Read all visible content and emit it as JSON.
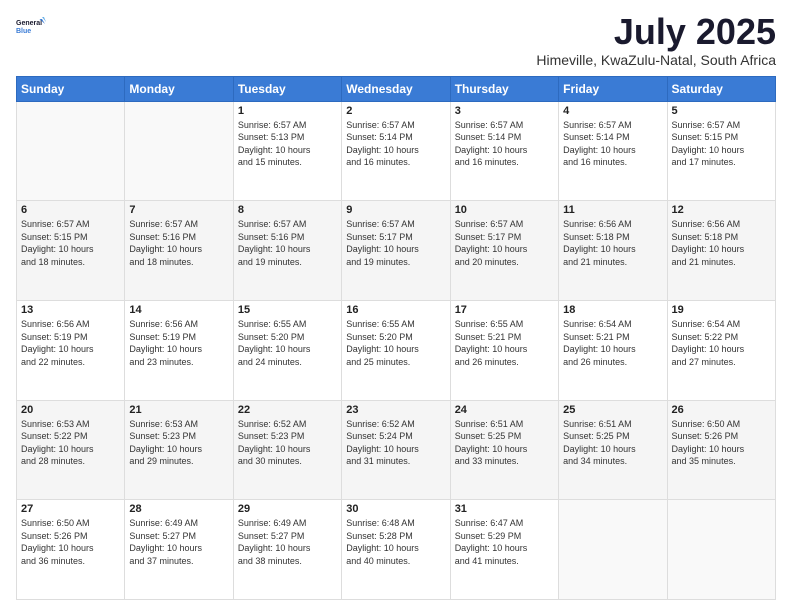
{
  "logo": {
    "line1": "General",
    "line2": "Blue"
  },
  "title": "July 2025",
  "subtitle": "Himeville, KwaZulu-Natal, South Africa",
  "days_of_week": [
    "Sunday",
    "Monday",
    "Tuesday",
    "Wednesday",
    "Thursday",
    "Friday",
    "Saturday"
  ],
  "weeks": [
    [
      {
        "day": "",
        "info": ""
      },
      {
        "day": "",
        "info": ""
      },
      {
        "day": "1",
        "info": "Sunrise: 6:57 AM\nSunset: 5:13 PM\nDaylight: 10 hours\nand 15 minutes."
      },
      {
        "day": "2",
        "info": "Sunrise: 6:57 AM\nSunset: 5:14 PM\nDaylight: 10 hours\nand 16 minutes."
      },
      {
        "day": "3",
        "info": "Sunrise: 6:57 AM\nSunset: 5:14 PM\nDaylight: 10 hours\nand 16 minutes."
      },
      {
        "day": "4",
        "info": "Sunrise: 6:57 AM\nSunset: 5:14 PM\nDaylight: 10 hours\nand 16 minutes."
      },
      {
        "day": "5",
        "info": "Sunrise: 6:57 AM\nSunset: 5:15 PM\nDaylight: 10 hours\nand 17 minutes."
      }
    ],
    [
      {
        "day": "6",
        "info": "Sunrise: 6:57 AM\nSunset: 5:15 PM\nDaylight: 10 hours\nand 18 minutes."
      },
      {
        "day": "7",
        "info": "Sunrise: 6:57 AM\nSunset: 5:16 PM\nDaylight: 10 hours\nand 18 minutes."
      },
      {
        "day": "8",
        "info": "Sunrise: 6:57 AM\nSunset: 5:16 PM\nDaylight: 10 hours\nand 19 minutes."
      },
      {
        "day": "9",
        "info": "Sunrise: 6:57 AM\nSunset: 5:17 PM\nDaylight: 10 hours\nand 19 minutes."
      },
      {
        "day": "10",
        "info": "Sunrise: 6:57 AM\nSunset: 5:17 PM\nDaylight: 10 hours\nand 20 minutes."
      },
      {
        "day": "11",
        "info": "Sunrise: 6:56 AM\nSunset: 5:18 PM\nDaylight: 10 hours\nand 21 minutes."
      },
      {
        "day": "12",
        "info": "Sunrise: 6:56 AM\nSunset: 5:18 PM\nDaylight: 10 hours\nand 21 minutes."
      }
    ],
    [
      {
        "day": "13",
        "info": "Sunrise: 6:56 AM\nSunset: 5:19 PM\nDaylight: 10 hours\nand 22 minutes."
      },
      {
        "day": "14",
        "info": "Sunrise: 6:56 AM\nSunset: 5:19 PM\nDaylight: 10 hours\nand 23 minutes."
      },
      {
        "day": "15",
        "info": "Sunrise: 6:55 AM\nSunset: 5:20 PM\nDaylight: 10 hours\nand 24 minutes."
      },
      {
        "day": "16",
        "info": "Sunrise: 6:55 AM\nSunset: 5:20 PM\nDaylight: 10 hours\nand 25 minutes."
      },
      {
        "day": "17",
        "info": "Sunrise: 6:55 AM\nSunset: 5:21 PM\nDaylight: 10 hours\nand 26 minutes."
      },
      {
        "day": "18",
        "info": "Sunrise: 6:54 AM\nSunset: 5:21 PM\nDaylight: 10 hours\nand 26 minutes."
      },
      {
        "day": "19",
        "info": "Sunrise: 6:54 AM\nSunset: 5:22 PM\nDaylight: 10 hours\nand 27 minutes."
      }
    ],
    [
      {
        "day": "20",
        "info": "Sunrise: 6:53 AM\nSunset: 5:22 PM\nDaylight: 10 hours\nand 28 minutes."
      },
      {
        "day": "21",
        "info": "Sunrise: 6:53 AM\nSunset: 5:23 PM\nDaylight: 10 hours\nand 29 minutes."
      },
      {
        "day": "22",
        "info": "Sunrise: 6:52 AM\nSunset: 5:23 PM\nDaylight: 10 hours\nand 30 minutes."
      },
      {
        "day": "23",
        "info": "Sunrise: 6:52 AM\nSunset: 5:24 PM\nDaylight: 10 hours\nand 31 minutes."
      },
      {
        "day": "24",
        "info": "Sunrise: 6:51 AM\nSunset: 5:25 PM\nDaylight: 10 hours\nand 33 minutes."
      },
      {
        "day": "25",
        "info": "Sunrise: 6:51 AM\nSunset: 5:25 PM\nDaylight: 10 hours\nand 34 minutes."
      },
      {
        "day": "26",
        "info": "Sunrise: 6:50 AM\nSunset: 5:26 PM\nDaylight: 10 hours\nand 35 minutes."
      }
    ],
    [
      {
        "day": "27",
        "info": "Sunrise: 6:50 AM\nSunset: 5:26 PM\nDaylight: 10 hours\nand 36 minutes."
      },
      {
        "day": "28",
        "info": "Sunrise: 6:49 AM\nSunset: 5:27 PM\nDaylight: 10 hours\nand 37 minutes."
      },
      {
        "day": "29",
        "info": "Sunrise: 6:49 AM\nSunset: 5:27 PM\nDaylight: 10 hours\nand 38 minutes."
      },
      {
        "day": "30",
        "info": "Sunrise: 6:48 AM\nSunset: 5:28 PM\nDaylight: 10 hours\nand 40 minutes."
      },
      {
        "day": "31",
        "info": "Sunrise: 6:47 AM\nSunset: 5:29 PM\nDaylight: 10 hours\nand 41 minutes."
      },
      {
        "day": "",
        "info": ""
      },
      {
        "day": "",
        "info": ""
      }
    ]
  ]
}
